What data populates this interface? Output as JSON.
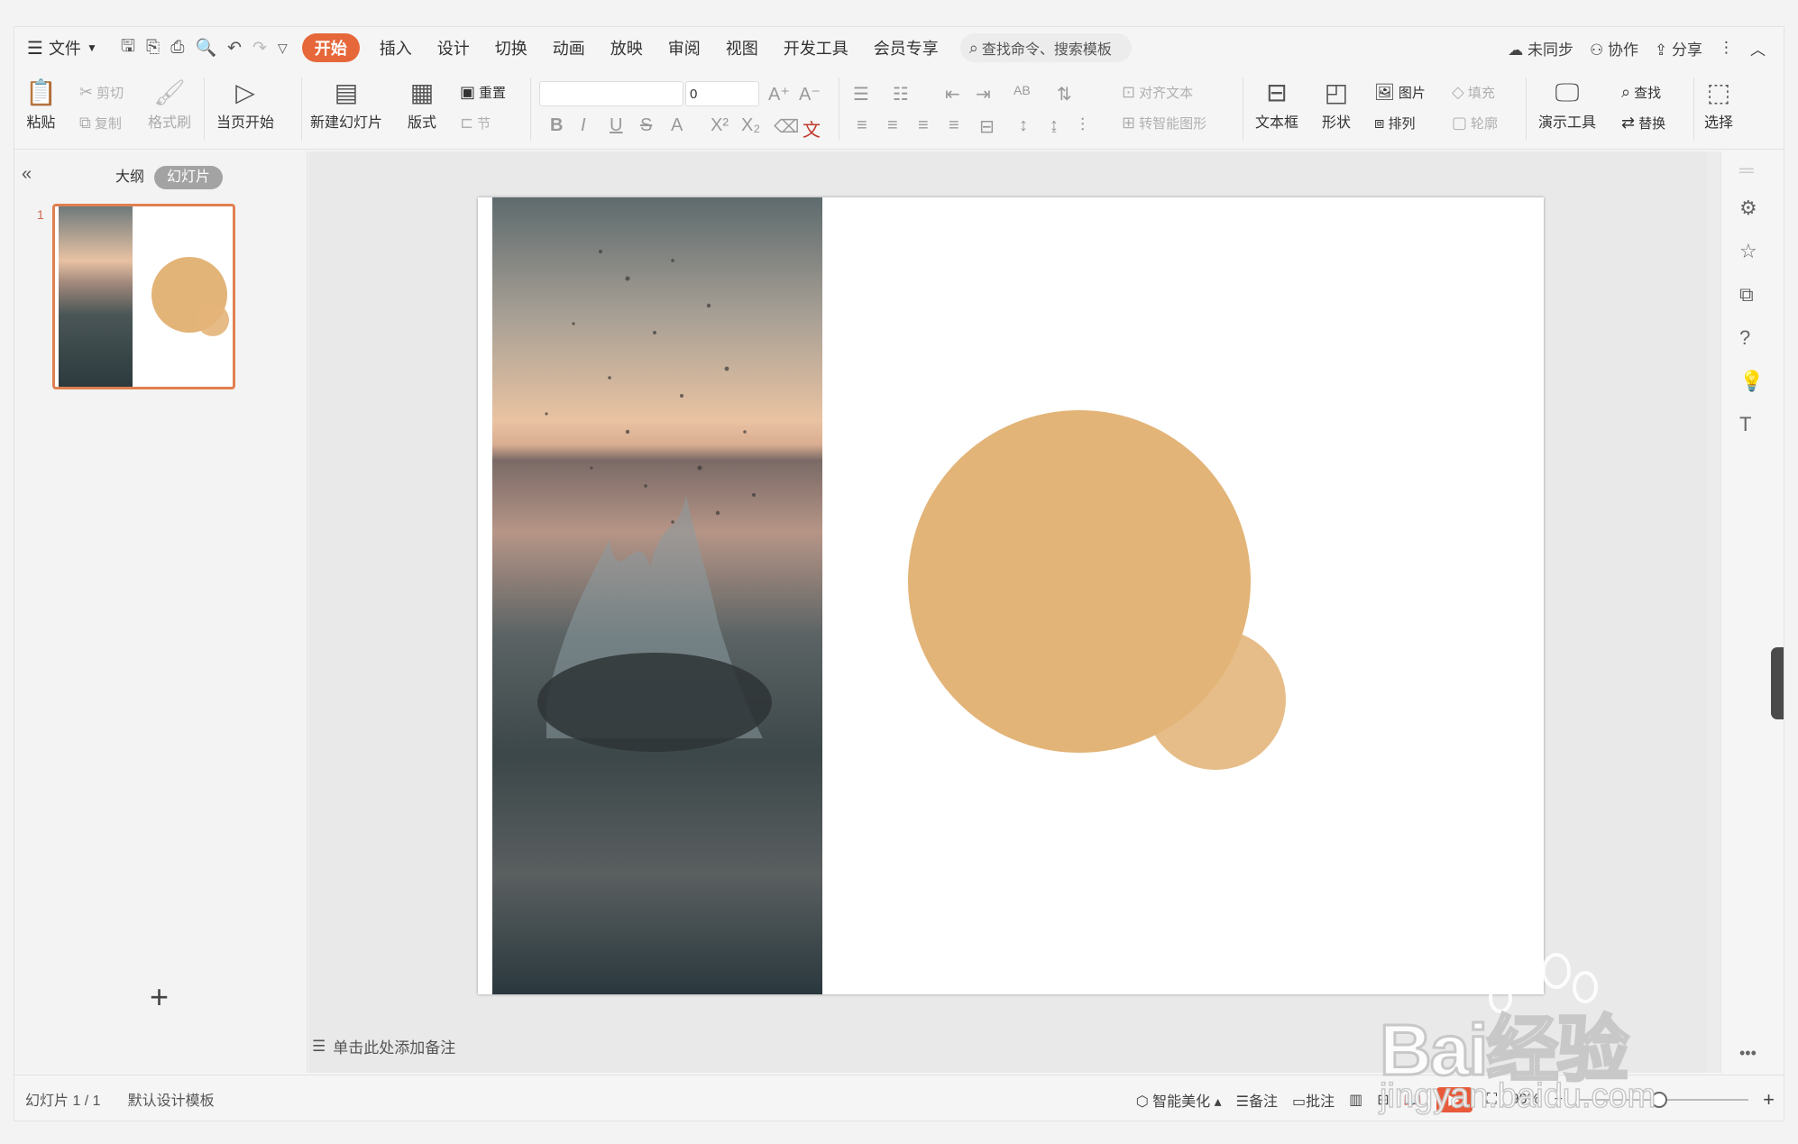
{
  "menu": {
    "file": "文件",
    "tabs": [
      "开始",
      "插入",
      "设计",
      "切换",
      "动画",
      "放映",
      "审阅",
      "视图",
      "开发工具",
      "会员专享"
    ],
    "search_placeholder": "查找命令、搜索模板",
    "unsynced": "未同步",
    "collab": "协作",
    "share": "分享"
  },
  "ribbon": {
    "paste": "粘贴",
    "cut": "剪切",
    "copy": "复制",
    "format_painter": "格式刷",
    "play_from_current": "当页开始",
    "new_slide": "新建幻灯片",
    "layout": "版式",
    "reset": "重置",
    "section": "节",
    "font_size": "0",
    "align_text": "对齐文本",
    "to_smartart": "转智能图形",
    "textbox": "文本框",
    "shapes": "形状",
    "picture": "图片",
    "fill": "填充",
    "arrange": "排列",
    "outline": "轮廓",
    "present_tools": "演示工具",
    "find": "查找",
    "replace": "替换",
    "select": "选择"
  },
  "left_panel": {
    "tab_outline": "大纲",
    "tab_slides": "幻灯片",
    "slide_number": "1"
  },
  "notes_placeholder": "单击此处添加备注",
  "status": {
    "slide_count": "幻灯片 1 / 1",
    "template": "默认设计模板",
    "beautify": "智能美化",
    "notes": "备注",
    "comments": "批注",
    "zoom": "90%"
  },
  "slide": {
    "circle_color": "#e3b478",
    "accent": "#e6683a"
  },
  "watermark": {
    "brand": "Bai经验",
    "url": "jingyan.baidu.com"
  }
}
